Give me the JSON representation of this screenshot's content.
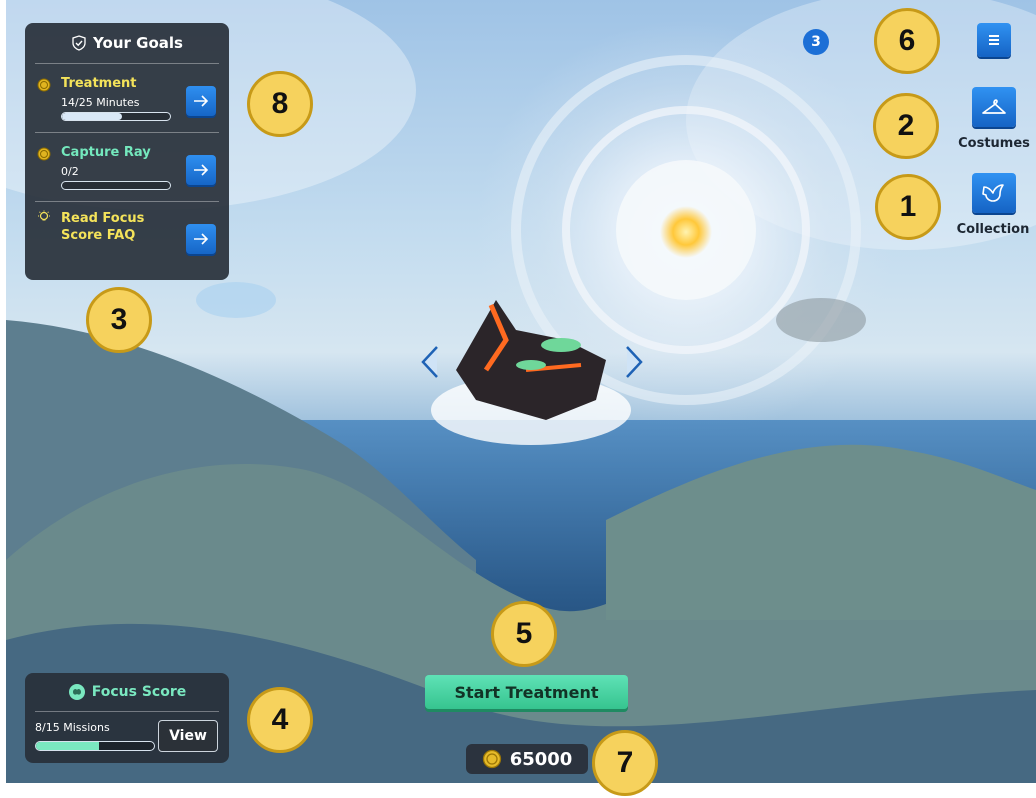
{
  "goals": {
    "title": "Your Goals",
    "items": [
      {
        "name": "Treatment",
        "progress": "14/25 Minutes",
        "fraction": 0.56,
        "icon": "coin-icon",
        "color": "#f4e35a"
      },
      {
        "name": "Capture Ray",
        "progress": "0/2",
        "fraction": 0.0,
        "icon": "coin-icon",
        "color": "#74e8bd"
      },
      {
        "name": "Read Focus Score FAQ",
        "progress": "",
        "icon": "lightbulb-icon",
        "color": "#f4e35a"
      }
    ]
  },
  "focus": {
    "title": "Focus Score",
    "missions": "8/15 Missions",
    "fraction": 0.533,
    "view_label": "View",
    "color": "#7ae8c0"
  },
  "side": {
    "notification_count": "3",
    "costumes_label": "Costumes",
    "collection_label": "Collection"
  },
  "main": {
    "start_label": "Start Treatment",
    "coins": "65000"
  },
  "callouts": {
    "c1": "1",
    "c2": "2",
    "c3": "3",
    "c4": "4",
    "c5": "5",
    "c6": "6",
    "c7": "7",
    "c8": "8"
  },
  "colors": {
    "accent_blue": "#1c6fd6",
    "start_green": "#36c48f",
    "callout_yellow": "#f6d25d",
    "panel_dark": "#28303a"
  }
}
